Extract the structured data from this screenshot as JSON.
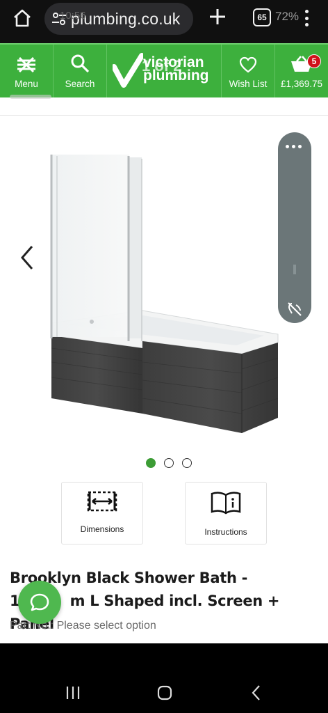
{
  "browser": {
    "url": "plumbing.co.uk",
    "url_ghost": "10:56",
    "tabs_count": "65",
    "battery_ghost": "72%"
  },
  "header": {
    "menu_label": "Menu",
    "search_label": "Search",
    "logo_line1": "victorian",
    "logo_line2": "plumbing",
    "logo_overlay": "1 of 2",
    "wishlist_label": "Wish List",
    "basket_total": "£1,369.75",
    "basket_count": "5"
  },
  "gallery": {
    "active_slide": 1,
    "slide_count": 3
  },
  "features": {
    "dimensions_label": "Dimensions",
    "instructions_label": "Instructions"
  },
  "product": {
    "title_line1": "Brooklyn Black Shower Bath -",
    "title_line2_start": "17",
    "title_line2_end": "m L Shaped incl. Screen + Panel",
    "part_no": "Part No.: Please select option"
  },
  "colors": {
    "brand_green": "#3db03d",
    "badge_red": "#d0121b",
    "dot_active": "#3c9c35"
  }
}
